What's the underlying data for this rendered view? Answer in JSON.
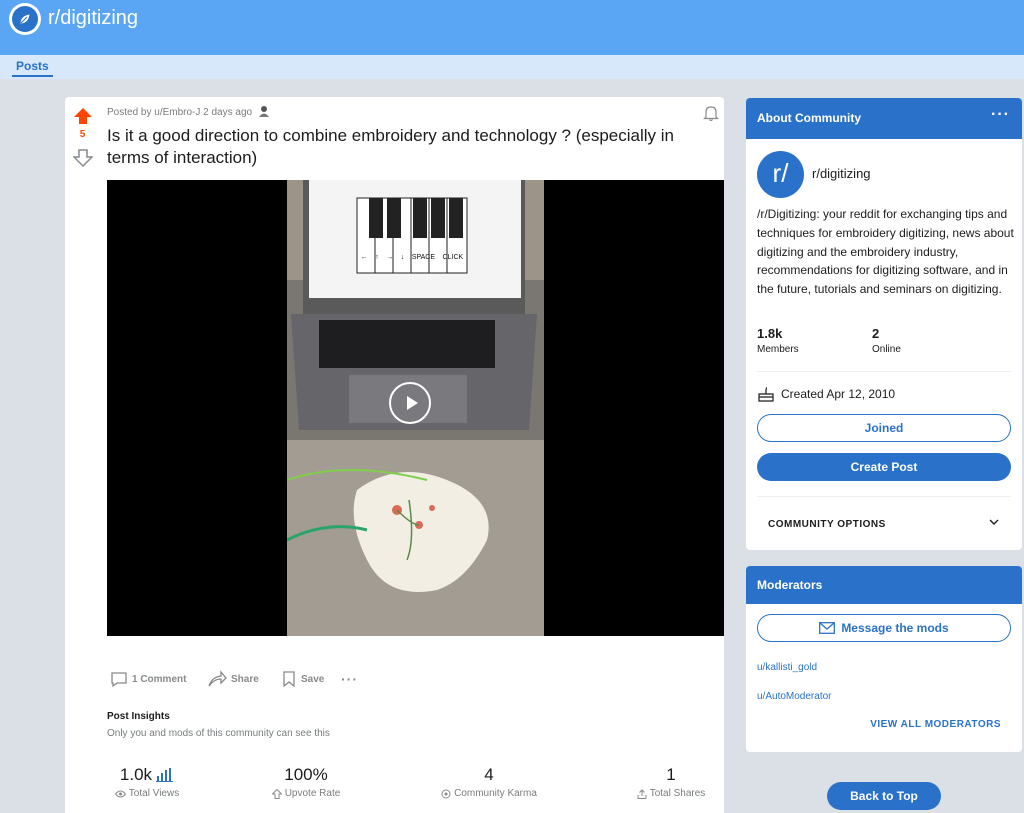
{
  "header": {
    "title": "r/digitizing"
  },
  "tabs": [
    {
      "label": "Posts"
    }
  ],
  "post": {
    "vote_count": "5",
    "meta": "Posted by u/Embro-J 2 days ago",
    "title": "Is it a good direction to combine embroidery and technology ? (especially in terms of interaction)",
    "video": {
      "keys": [
        "←",
        "↑",
        "→",
        "↓",
        "SPACE",
        "CLICK"
      ]
    },
    "actions": {
      "comment": "1 Comment",
      "share": "Share",
      "save": "Save"
    },
    "insights": {
      "title": "Post Insights",
      "subtitle": "Only you and mods of this community can see this",
      "stats": [
        {
          "value": "1.0k",
          "label": "Total Views"
        },
        {
          "value": "100%",
          "label": "Upvote Rate"
        },
        {
          "value": "4",
          "label": "Community Karma"
        },
        {
          "value": "1",
          "label": "Total Shares"
        }
      ]
    }
  },
  "about": {
    "header": "About Community",
    "avatar_text": "r/",
    "name": "r/digitizing",
    "description": "/r/Digitizing: your reddit for exchanging tips and techniques for embroidery digitizing, news about digitizing and the embroidery industry, recommendations for digitizing software, and in the future, tutorials and seminars on digitizing.",
    "members": {
      "value": "1.8k",
      "label": "Members"
    },
    "online": {
      "value": "2",
      "label": "Online"
    },
    "created": "Created Apr 12, 2010",
    "joined_label": "Joined",
    "create_post_label": "Create Post",
    "options_label": "COMMUNITY OPTIONS"
  },
  "moderators": {
    "header": "Moderators",
    "message_label": "Message the mods",
    "list": [
      "u/kallisti_gold",
      "u/AutoModerator"
    ],
    "view_all": "VIEW ALL MODERATORS"
  },
  "back_to_top": "Back to Top",
  "colors": {
    "brand_blue": "#2a72c9",
    "header_blue": "#5aa6f5",
    "upvote": "#ff4500"
  }
}
